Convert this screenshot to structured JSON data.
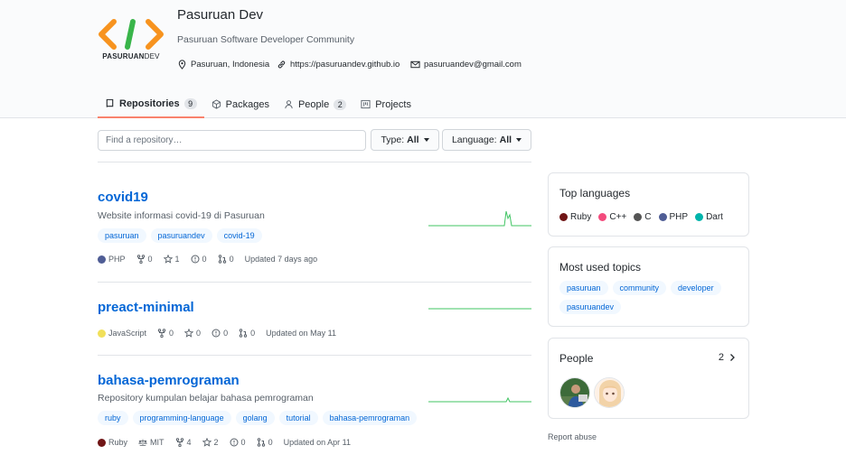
{
  "org": {
    "logo_text_bold": "PASURUAN",
    "logo_text_light": "DEV",
    "name": "Pasuruan Dev",
    "description": "Pasuruan Software Developer Community",
    "location": "Pasuruan, Indonesia",
    "website": "https://pasuruandev.github.io",
    "email": "pasuruandev@gmail.com"
  },
  "tabs": [
    {
      "label": "Repositories",
      "count": "9",
      "icon": "repo-icon",
      "selected": true
    },
    {
      "label": "Packages",
      "icon": "package-icon"
    },
    {
      "label": "People",
      "count": "2",
      "icon": "person-icon"
    },
    {
      "label": "Projects",
      "icon": "project-icon"
    }
  ],
  "filters": {
    "search_placeholder": "Find a repository…",
    "type_label": "Type:",
    "type_value": "All",
    "language_label": "Language:",
    "language_value": "All"
  },
  "repos": [
    {
      "name": "covid19",
      "description": "Website informasi covid-19 di Pasuruan",
      "topics": [
        "pasuruan",
        "pasuruandev",
        "covid-19"
      ],
      "language": "PHP",
      "language_color": "#4F5D95",
      "forks": "0",
      "stars": "1",
      "issues": "0",
      "pulls": "0",
      "updated": "Updated 7 days ago",
      "activity": "spike"
    },
    {
      "name": "preact-minimal",
      "description": "",
      "topics": [],
      "language": "JavaScript",
      "language_color": "#f1e05a",
      "forks": "0",
      "stars": "0",
      "issues": "0",
      "pulls": "0",
      "updated": "Updated on May 11",
      "activity": "flat"
    },
    {
      "name": "bahasa-pemrograman",
      "description": "Repository kumpulan belajar bahasa pemrograman",
      "topics": [
        "ruby",
        "programming-language",
        "golang",
        "tutorial",
        "bahasa-pemrograman"
      ],
      "language": "Ruby",
      "language_color": "#701516",
      "license": "MIT",
      "forks": "4",
      "stars": "2",
      "issues": "0",
      "pulls": "0",
      "updated": "Updated on Apr 11",
      "activity": "small"
    }
  ],
  "sidebar": {
    "top_languages_title": "Top languages",
    "languages": [
      {
        "name": "Ruby",
        "color": "#701516"
      },
      {
        "name": "C++",
        "color": "#f34b7d"
      },
      {
        "name": "C",
        "color": "#555555"
      },
      {
        "name": "PHP",
        "color": "#4F5D95"
      },
      {
        "name": "Dart",
        "color": "#00B4AB"
      }
    ],
    "topics_title": "Most used topics",
    "topics": [
      "pasuruan",
      "community",
      "developer",
      "pasuruandev"
    ],
    "people_title": "People",
    "people_count": "2",
    "report": "Report abuse"
  },
  "colors": {
    "accent_tab": "#f9826c",
    "link": "#0366d6",
    "sparkline": "#40c463"
  }
}
